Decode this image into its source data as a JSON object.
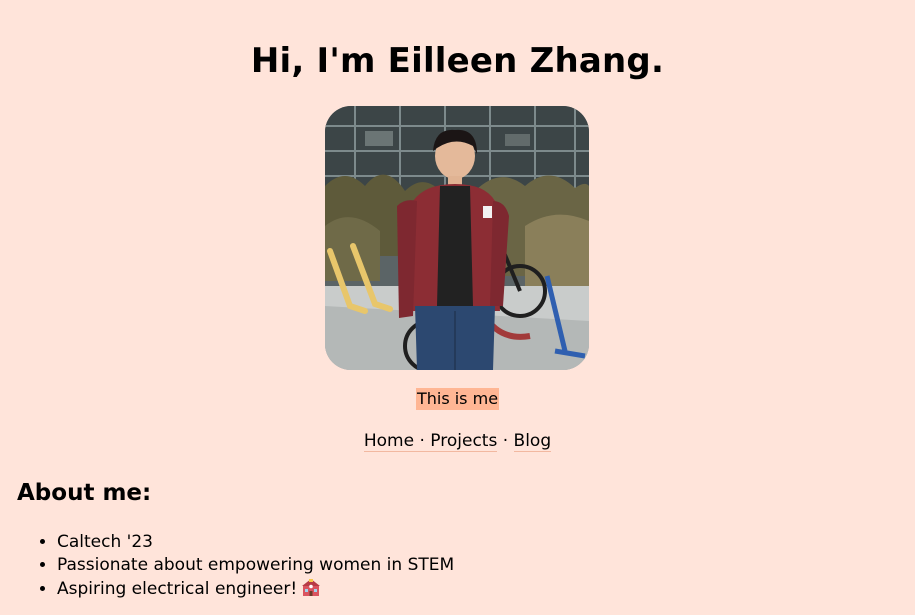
{
  "header": {
    "title": "Hi, I'm Eilleen Zhang."
  },
  "profile": {
    "photo_alt": "This is me",
    "caption": "This is me"
  },
  "nav": {
    "home": "Home",
    "sep1": " · ",
    "projects": "Projects",
    "sep2": " · ",
    "blog": "Blog"
  },
  "about": {
    "heading": "About me:",
    "items": [
      "Caltech '23",
      "Passionate about empowering women in STEM",
      "Aspiring electrical engineer!"
    ],
    "emoji_icon": "school-building-icon"
  },
  "colors": {
    "background": "#ffe4da",
    "caption_highlight": "#ffb694",
    "link": "#1a0dab"
  }
}
